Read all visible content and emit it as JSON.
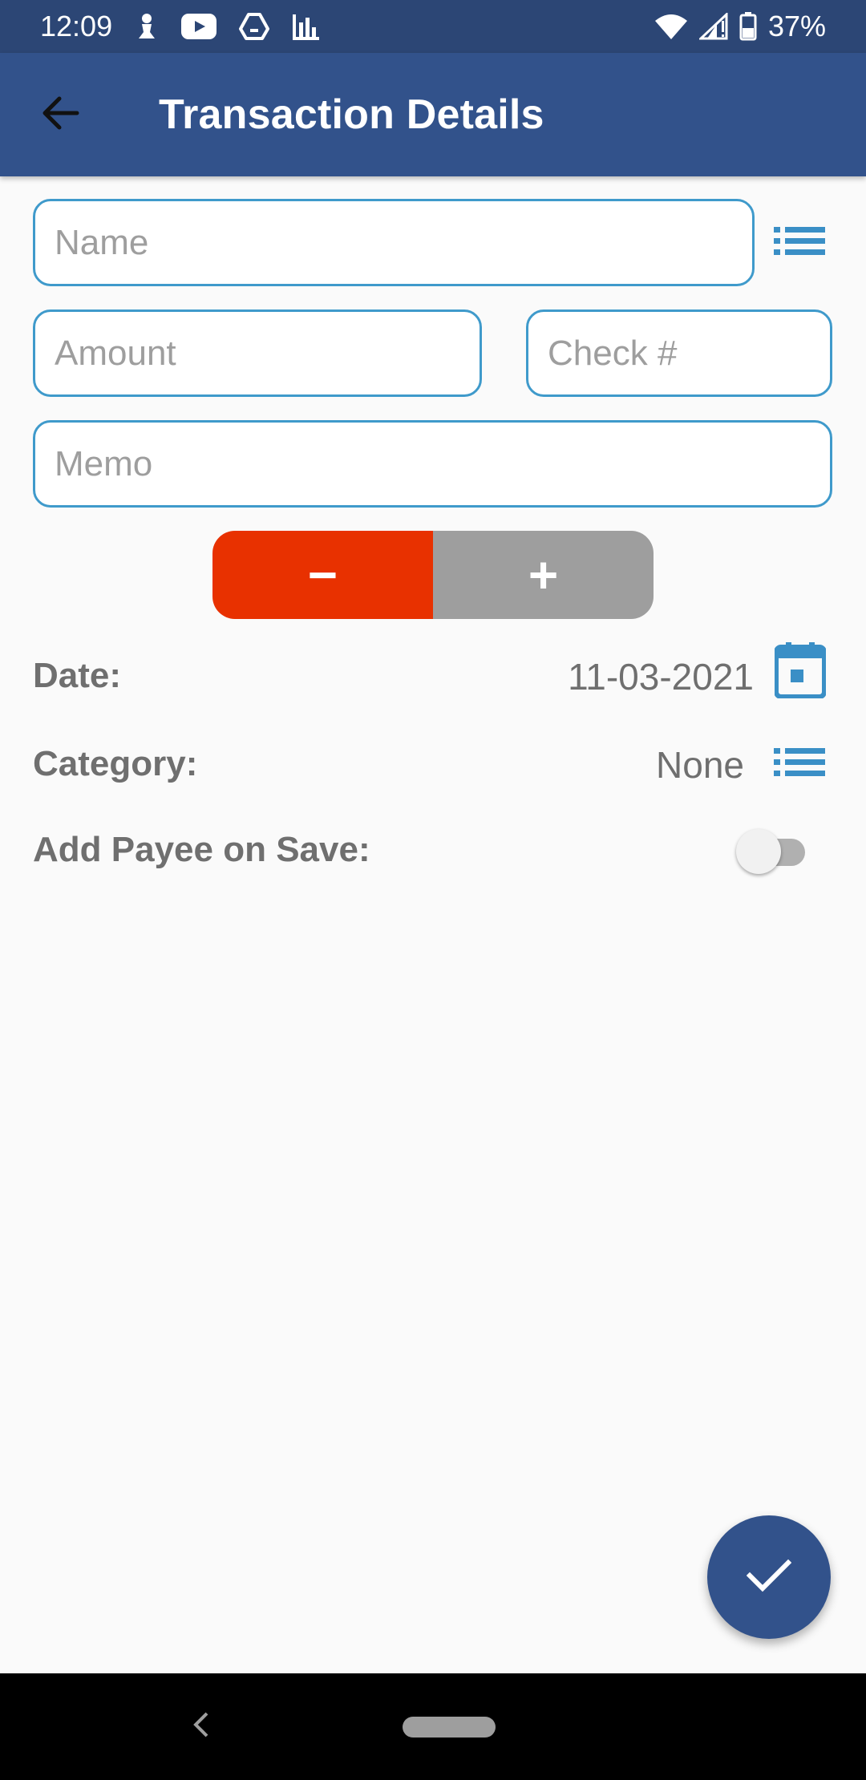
{
  "status_bar": {
    "time": "12:09",
    "battery": "37%",
    "icons": [
      "chess-pawn-icon",
      "youtube-icon",
      "drive-icon",
      "bar-chart-icon",
      "wifi-icon",
      "signal-icon",
      "battery-icon"
    ]
  },
  "app_bar": {
    "title": "Transaction Details",
    "back_icon": "arrow-left-icon"
  },
  "form": {
    "name_placeholder": "Name",
    "amount_placeholder": "Amount",
    "check_placeholder": "Check #",
    "memo_placeholder": "Memo",
    "minus_label": "−",
    "plus_label": "+",
    "date_label": "Date:",
    "date_value": "11-03-2021",
    "category_label": "Category:",
    "category_value": "None",
    "add_payee_label": "Add Payee on Save:",
    "add_payee_enabled": false
  },
  "colors": {
    "status_bar": "#2c4675",
    "app_bar": "#32528b",
    "accent": "#3f9acb",
    "minus": "#e83100",
    "plus": "#9e9e9e",
    "fab": "#32528b"
  }
}
